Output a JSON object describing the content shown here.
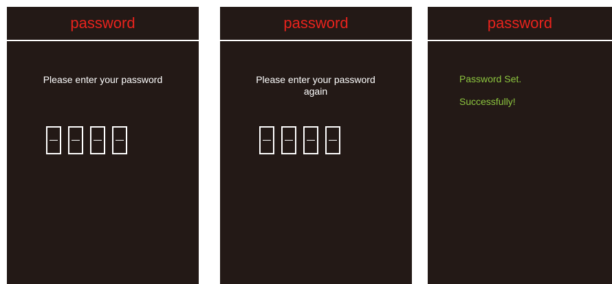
{
  "panels": [
    {
      "header": "password",
      "prompt": "Please enter your password",
      "digits": [
        "–",
        "–",
        "–",
        "–"
      ]
    },
    {
      "header": "password",
      "prompt": "Please enter your password again",
      "digits": [
        "–",
        "–",
        "–",
        "–"
      ]
    },
    {
      "header": "password",
      "success_lines": [
        "Password Set.",
        "Successfully!"
      ]
    }
  ],
  "colors": {
    "background": "#231916",
    "header_text": "#e8231d",
    "success_text": "#8dc63f",
    "text": "#ffffff"
  }
}
